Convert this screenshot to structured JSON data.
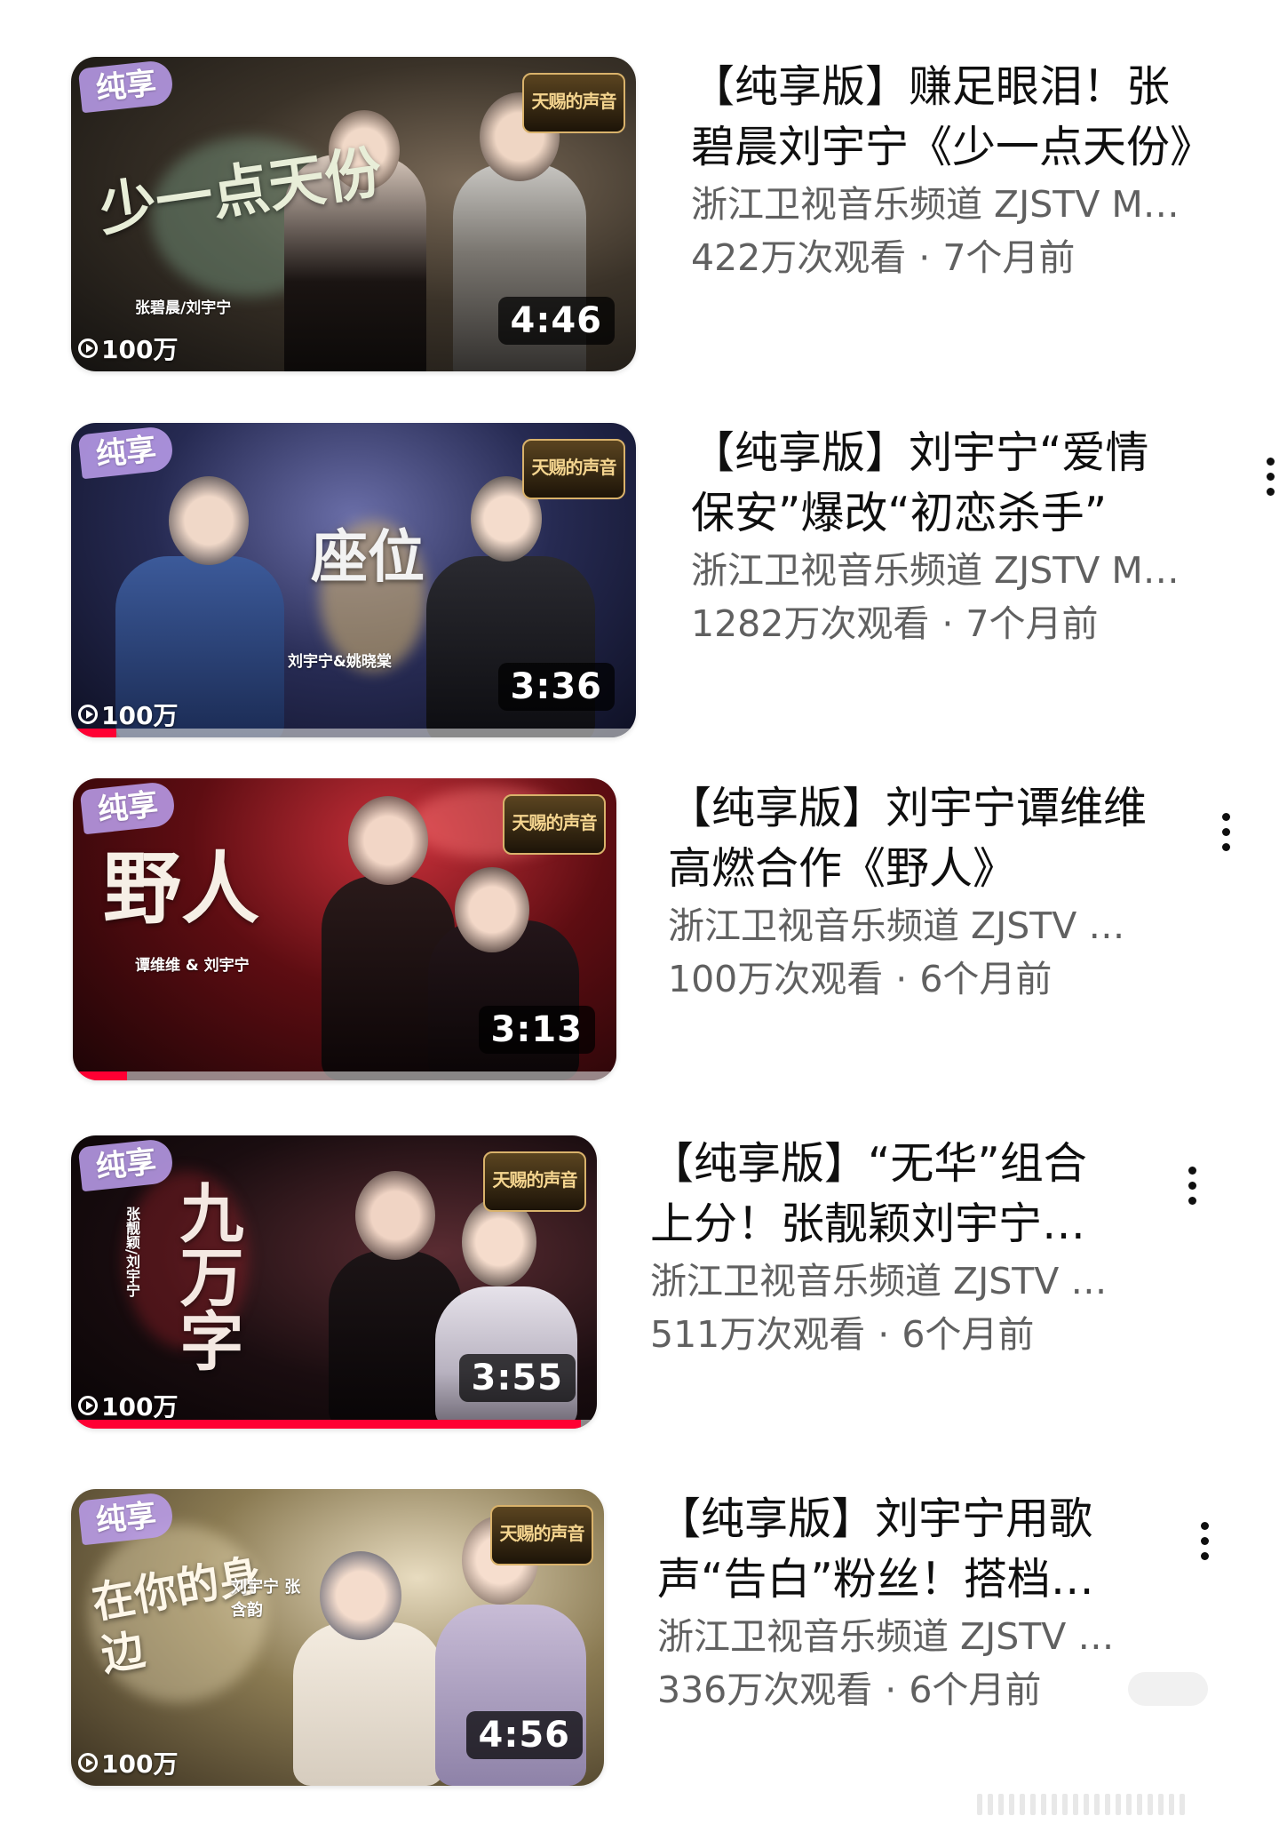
{
  "videos": [
    {
      "title": "【纯享版】赚足眼泪！张碧晨刘宇宁《少一点天份》",
      "channel": "浙江卫视音乐频道 ZJSTV Music",
      "views": "422万次观看",
      "age": "7个月前",
      "duration": "4:46",
      "badge": "纯享",
      "show_logo": "天赐的声音",
      "art_title": "少一点天份",
      "artists": "张碧晨/刘宇宁",
      "play_count": "100万",
      "progress": 0,
      "theme": "#3a3228"
    },
    {
      "title": "【纯享版】刘宇宁“爱情保安”爆改“初恋杀手”",
      "channel": "浙江卫视音乐频道 ZJSTV Music",
      "views": "1282万次观看",
      "age": "7个月前",
      "duration": "3:36",
      "badge": "纯享",
      "show_logo": "天赐的声音",
      "art_title": "座位",
      "artists": "刘宇宁&姚晓棠",
      "play_count": "100万",
      "progress": 0.08,
      "theme": "#262a52"
    },
    {
      "title": "【纯享版】刘宇宁谭维维高燃合作《野人》",
      "channel": "浙江卫视音乐频道 ZJSTV Music",
      "views": "100万次观看",
      "age": "6个月前",
      "duration": "3:13",
      "badge": "纯享",
      "show_logo": "天赐的声音",
      "art_title": "野人",
      "artists": "谭维维 & 刘宇宁",
      "play_count": "",
      "progress": 0.1,
      "theme": "#5e0d12"
    },
    {
      "title": "【纯享版】“无华”组合上分！张靓颖刘宇宁《九万字》",
      "channel": "浙江卫视音乐频道 ZJSTV Music",
      "views": "511万次观看",
      "age": "6个月前",
      "duration": "3:55",
      "badge": "纯享",
      "show_logo": "天赐的声音",
      "art_title": "九万字",
      "artists": "张靓颖/刘宇宁",
      "play_count": "100万",
      "progress": 0.97,
      "theme": "#1a0d10"
    },
    {
      "title": "【纯享版】刘宇宁用歌声“告白”粉丝！搭档张含韵",
      "channel": "浙江卫视音乐频道 ZJSTV Music",
      "views": "336万次观看",
      "age": "6个月前",
      "duration": "4:56",
      "badge": "纯享",
      "show_logo": "天赐的声音",
      "art_title": "在你的身边",
      "artists": "刘宇宁 张含韵",
      "play_count": "100万",
      "progress": 0,
      "theme": "#8a7a52"
    }
  ]
}
